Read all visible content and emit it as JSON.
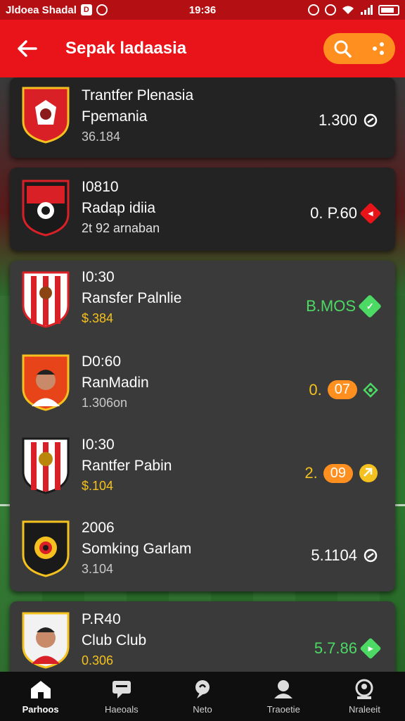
{
  "status_bar": {
    "carrier": "Jldoea Shadal",
    "time": "19:36"
  },
  "app_bar": {
    "title": "Sepak ladaasia"
  },
  "items": [
    {
      "line1": "Trantfer Plenasia",
      "line2": "Fpemania",
      "line3": "36.184",
      "value": "1.300",
      "accent": "#ffffff"
    },
    {
      "line1": "I0810",
      "line2": "Radap idiia",
      "line3": "2t 92 arnaban",
      "value": "0. P.60",
      "accent": "#ffffff"
    },
    {
      "line1": "I0:30",
      "line2": "Ransfer Palnlie",
      "line3": "$.384",
      "value": "B.MOS",
      "accent": "#4cd964"
    },
    {
      "line1": "D0:60",
      "line2": "RanMadin",
      "line3": "1.306on",
      "value_prefix": "0.",
      "value_pill": "07",
      "accent": "#f4c11f"
    },
    {
      "line1": "I0:30",
      "line2": "Rantfer Pabin",
      "line3": "$.104",
      "value_prefix": "2.",
      "value_pill": "09",
      "accent": "#f4c11f"
    },
    {
      "line1": "2006",
      "line2": "Somking Garlam",
      "line3": "3.104",
      "value": "5.1104",
      "accent": "#ffffff"
    },
    {
      "line1": "P.R40",
      "line2": "Club Club",
      "line3": "0.306",
      "value": "5.7.86",
      "accent": "#4cd964"
    }
  ],
  "bottom_nav": [
    {
      "label": "Parhoos",
      "icon": "home-icon"
    },
    {
      "label": "Haeoals",
      "icon": "chat-icon"
    },
    {
      "label": "Neto",
      "icon": "news-icon"
    },
    {
      "label": "Traoetie",
      "icon": "person-icon"
    },
    {
      "label": "Nraleeit",
      "icon": "profile-icon"
    }
  ],
  "colors": {
    "app_bar": "#e8141a",
    "accent_orange": "#ff8f1f",
    "green": "#4cd964",
    "gold": "#f4c11f",
    "red": "#e8141a"
  }
}
